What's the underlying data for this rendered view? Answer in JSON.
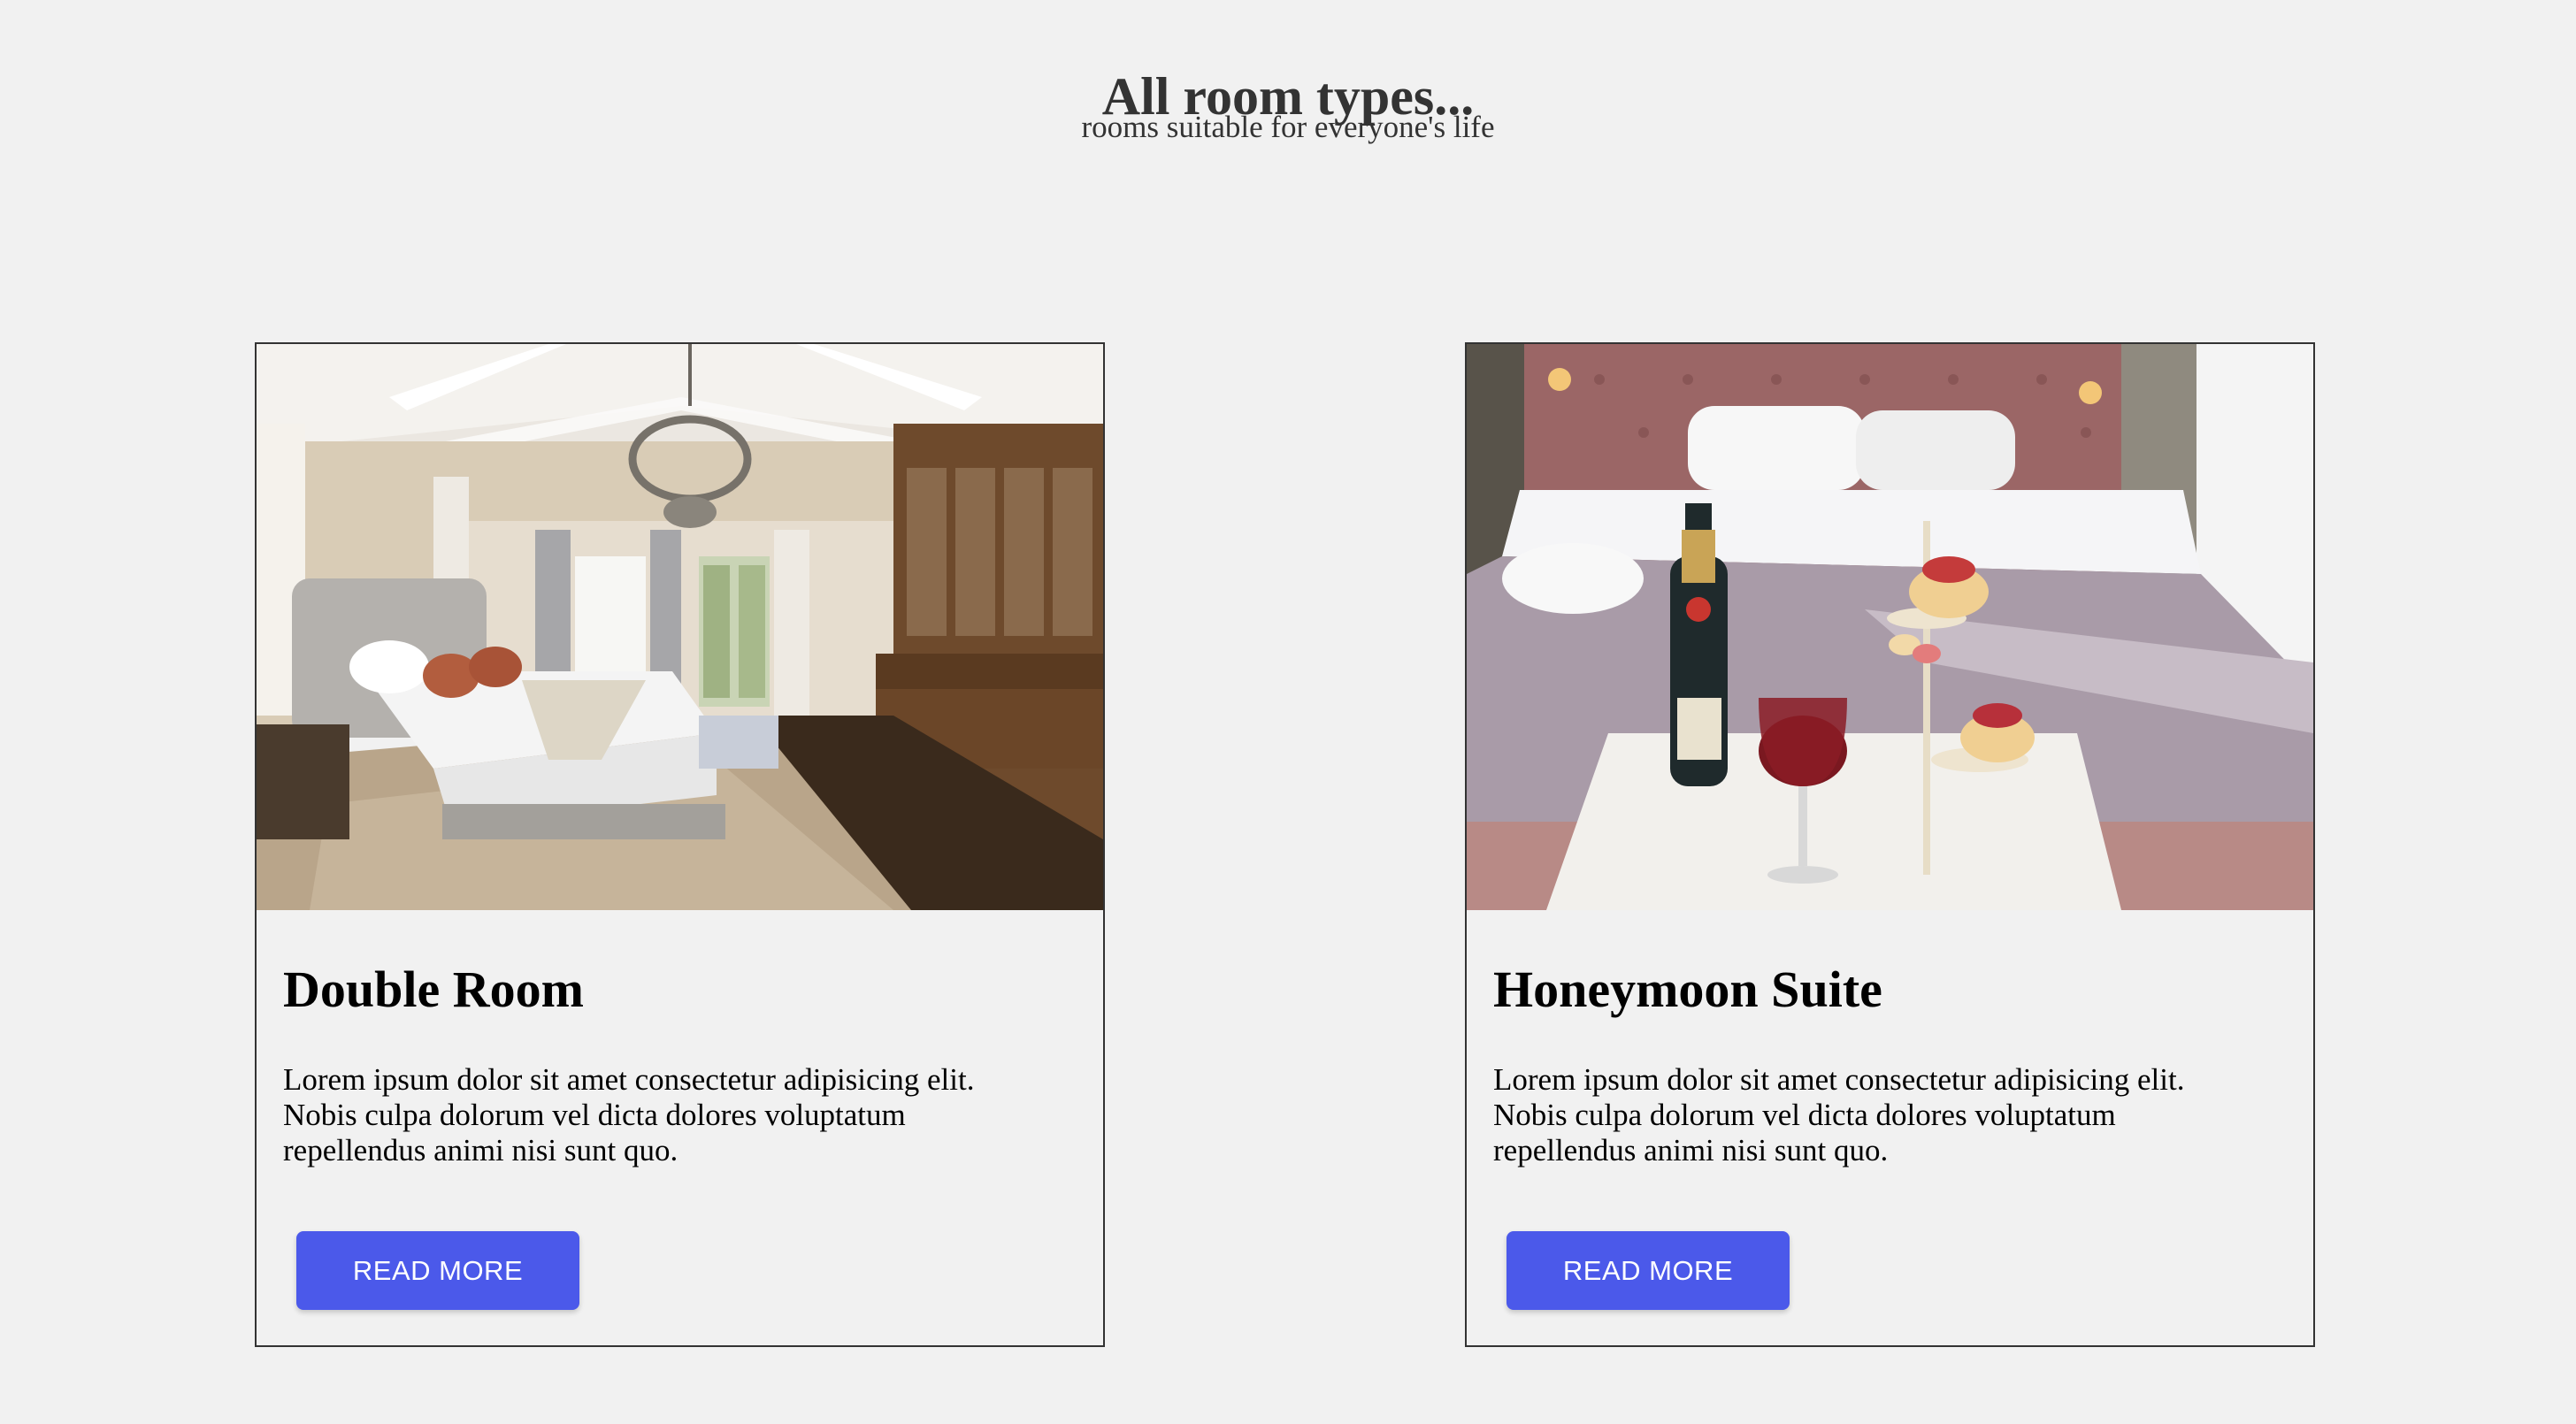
{
  "header": {
    "title": "All room types...",
    "subtitle": "rooms suitable for everyone's life"
  },
  "cards": [
    {
      "title": "Double Room",
      "text": "Lorem ipsum dolor sit amet consectetur adipisicing elit. Nobis culpa dolorum vel dicta dolores voluptatum repellendus animi nisi sunt quo.",
      "button_label": "READ MORE",
      "image_subject": "bedroom-photo"
    },
    {
      "title": "Honeymoon Suite",
      "text": "Lorem ipsum dolor sit amet consectetur adipisicing elit. Nobis culpa dolorum vel dicta dolores voluptatum repellendus animi nisi sunt quo.",
      "button_label": "READ MORE",
      "image_subject": "suite-photo"
    }
  ],
  "colors": {
    "background": "#f1f1f1",
    "button": "#4b59ea",
    "button_text": "#ffffff",
    "heading": "#333333"
  }
}
